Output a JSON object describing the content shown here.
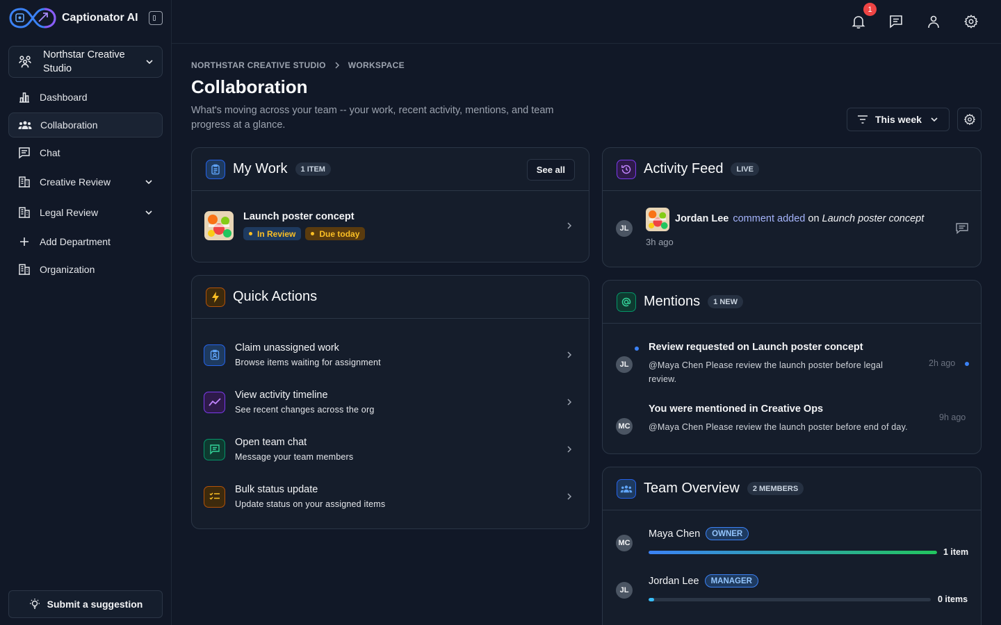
{
  "app": {
    "name": "Captionator AI"
  },
  "sidebar": {
    "org_name": "Northstar Creative Studio",
    "items": [
      {
        "label": "Dashboard",
        "icon": "bar-chart-icon"
      },
      {
        "label": "Collaboration",
        "icon": "team-icon",
        "active": true
      },
      {
        "label": "Chat",
        "icon": "chat-icon"
      },
      {
        "label": "Creative Review",
        "icon": "building-icon",
        "expandable": true
      },
      {
        "label": "Legal Review",
        "icon": "building-icon",
        "expandable": true
      },
      {
        "label": "Add Department",
        "icon": "plus-icon"
      },
      {
        "label": "Organization",
        "icon": "building-icon"
      }
    ],
    "suggest_label": "Submit a suggestion"
  },
  "topbar": {
    "notification_count": "1"
  },
  "header": {
    "breadcrumb": [
      "NORTHSTAR CREATIVE STUDIO",
      "WORKSPACE"
    ],
    "title": "Collaboration",
    "subtitle": "What's moving across your team -- your work, recent activity, mentions, and team progress at a glance.",
    "filter_label": "This week"
  },
  "my_work": {
    "title": "My Work",
    "badge": "1 ITEM",
    "see_all": "See all",
    "items": [
      {
        "title": "Launch poster concept",
        "status": "In Review",
        "due": "Due today"
      }
    ]
  },
  "quick_actions": {
    "title": "Quick Actions",
    "items": [
      {
        "title": "Claim unassigned work",
        "desc": "Browse items waiting for assignment",
        "icon": "clipboard-user-icon",
        "color": "#3b82f6"
      },
      {
        "title": "View activity timeline",
        "desc": "See recent changes across the org",
        "icon": "trend-icon",
        "color": "#a855f7"
      },
      {
        "title": "Open team chat",
        "desc": "Message your team members",
        "icon": "chat-icon",
        "color": "#10b981"
      },
      {
        "title": "Bulk status update",
        "desc": "Update status on your assigned items",
        "icon": "checklist-icon",
        "color": "#f59e0b"
      }
    ]
  },
  "activity": {
    "title": "Activity Feed",
    "badge": "LIVE",
    "items": [
      {
        "initials": "JL",
        "actor": "Jordan Lee",
        "action": "comment added",
        "prep": "on",
        "target": "Launch poster concept",
        "time": "3h ago"
      }
    ]
  },
  "mentions": {
    "title": "Mentions",
    "badge": "1 NEW",
    "items": [
      {
        "initials": "JL",
        "title": "Review requested on Launch poster concept",
        "body": "@Maya Chen Please review the launch poster before legal review.",
        "time": "2h ago",
        "unread": true
      },
      {
        "initials": "MC",
        "title": "You were mentioned in Creative Ops",
        "body": "@Maya Chen Please review the launch poster before end of day.",
        "time": "9h ago",
        "unread": false
      }
    ]
  },
  "team": {
    "title": "Team Overview",
    "badge": "2 MEMBERS",
    "members": [
      {
        "initials": "MC",
        "name": "Maya Chen",
        "role": "OWNER",
        "count": "1 item",
        "progress": 1.0
      },
      {
        "initials": "JL",
        "name": "Jordan Lee",
        "role": "MANAGER",
        "count": "0 items",
        "progress": 0.02
      }
    ]
  },
  "colors": {
    "accent": "#3b82f6",
    "bg": "#111827",
    "card": "#151d2b",
    "warning": "#fbbf24",
    "danger": "#ef4444"
  }
}
